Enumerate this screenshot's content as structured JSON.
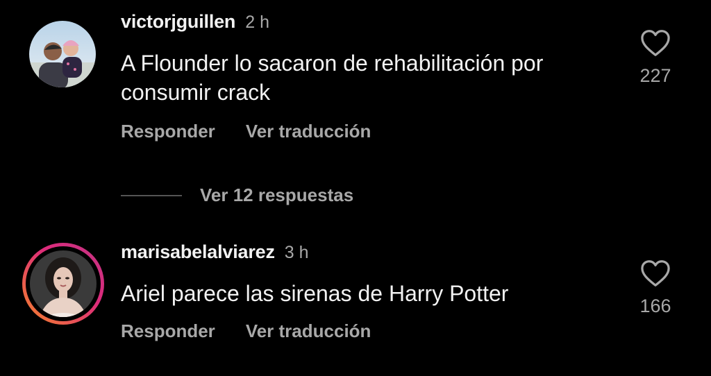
{
  "comments": [
    {
      "username": "victorjguillen",
      "time": "2 h",
      "text": "A Flounder lo sacaron de rehabilitación por consumir crack",
      "reply_label": "Responder",
      "translate_label": "Ver traducción",
      "likes": "227",
      "avatar_icon": "profile-photo"
    },
    {
      "username": "marisabelalviarez",
      "time": "3 h",
      "text": "Ariel parece las sirenas de Harry Potter",
      "reply_label": "Responder",
      "translate_label": "Ver traducción",
      "likes": "166",
      "avatar_icon": "profile-photo-story-ring"
    }
  ],
  "replies": {
    "label": "Ver 12 respuestas"
  },
  "colors": {
    "background": "#000000",
    "text": "#f2f2f2",
    "secondary": "#a8a8a8",
    "story_ring_start": "#f58529",
    "story_ring_end": "#dd2a7b"
  }
}
